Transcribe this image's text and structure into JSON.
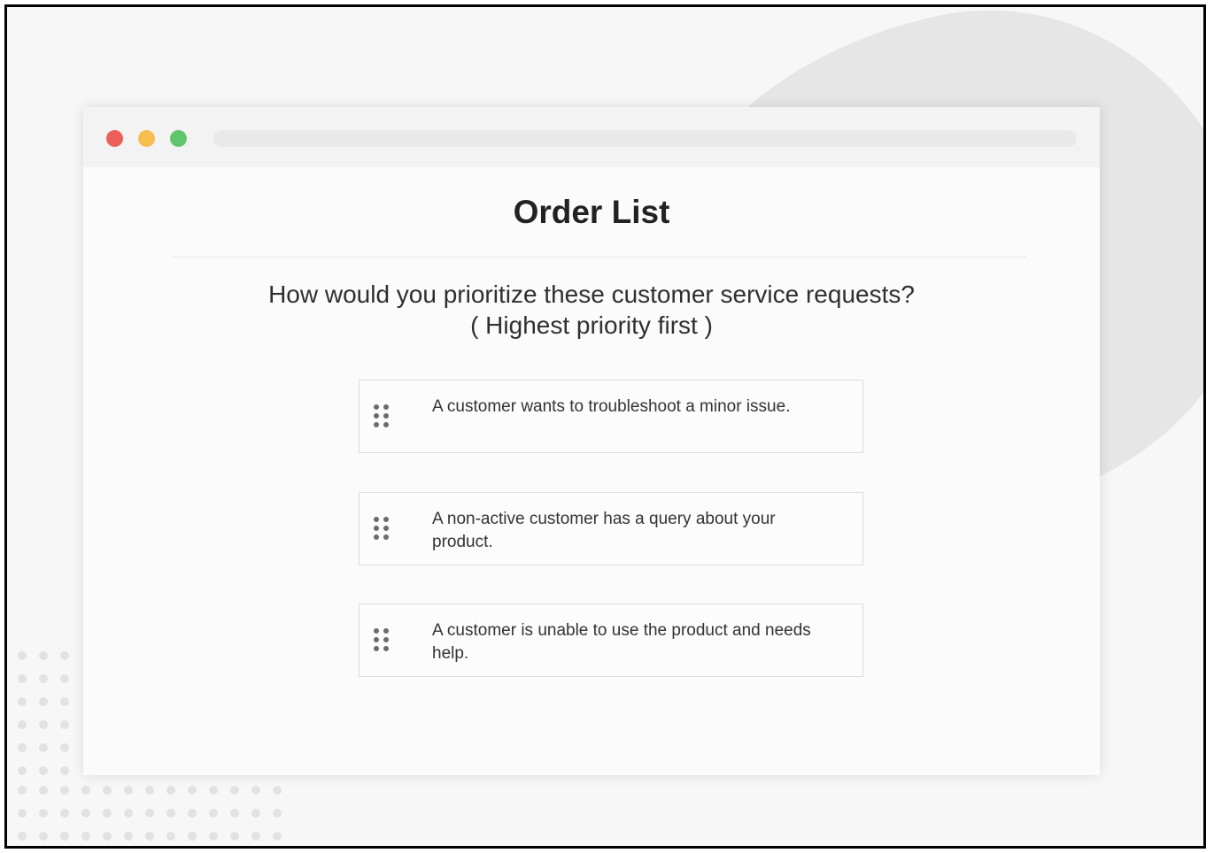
{
  "page": {
    "title": "Order List",
    "question_line1": "How would you prioritize these customer service requests?",
    "question_line2": "( Highest priority first )"
  },
  "window_controls": {
    "close_color": "#ec5f5a",
    "minimize_color": "#f5be4f",
    "maximize_color": "#5fc66d"
  },
  "order_items": [
    {
      "label": "A customer wants to troubleshoot a minor issue.",
      "icon": "drag-handle-icon"
    },
    {
      "label": "A non-active customer has a query about your product.",
      "icon": "drag-handle-icon"
    },
    {
      "label": "A customer is unable to use the product and needs help.",
      "icon": "drag-handle-icon"
    }
  ]
}
